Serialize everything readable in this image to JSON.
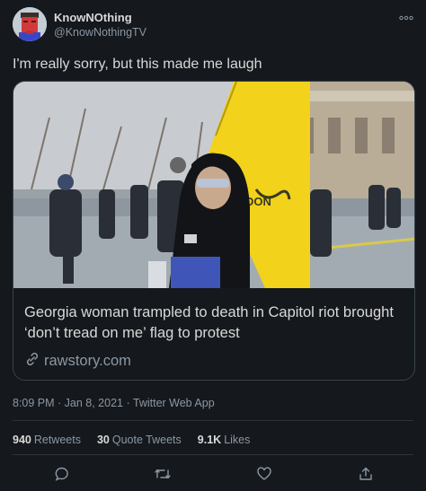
{
  "author": {
    "name": "KnowNOthing",
    "handle": "@KnowNothingTV"
  },
  "tweet": {
    "text": "I'm really sorry, but this made me laugh",
    "timestamp": "8:09 PM · Jan 8, 2021 · Twitter Web App"
  },
  "card": {
    "title": "Georgia woman trampled to death in Capitol riot brought ‘don’t tread on me’ flag to protest",
    "domain": "rawstory.com",
    "flag_text": "DON"
  },
  "stats": {
    "retweets_count": "940",
    "retweets_label": "Retweets",
    "quotes_count": "30",
    "quotes_label": "Quote Tweets",
    "likes_count": "9.1K",
    "likes_label": "Likes"
  },
  "actions": [
    "reply-icon",
    "retweet-icon",
    "like-icon",
    "share-icon"
  ],
  "colors": {
    "background": "#15181c",
    "text": "#d9d9d9",
    "muted": "#8b98a5",
    "border": "#38444d",
    "flag": "#f2d21a"
  }
}
